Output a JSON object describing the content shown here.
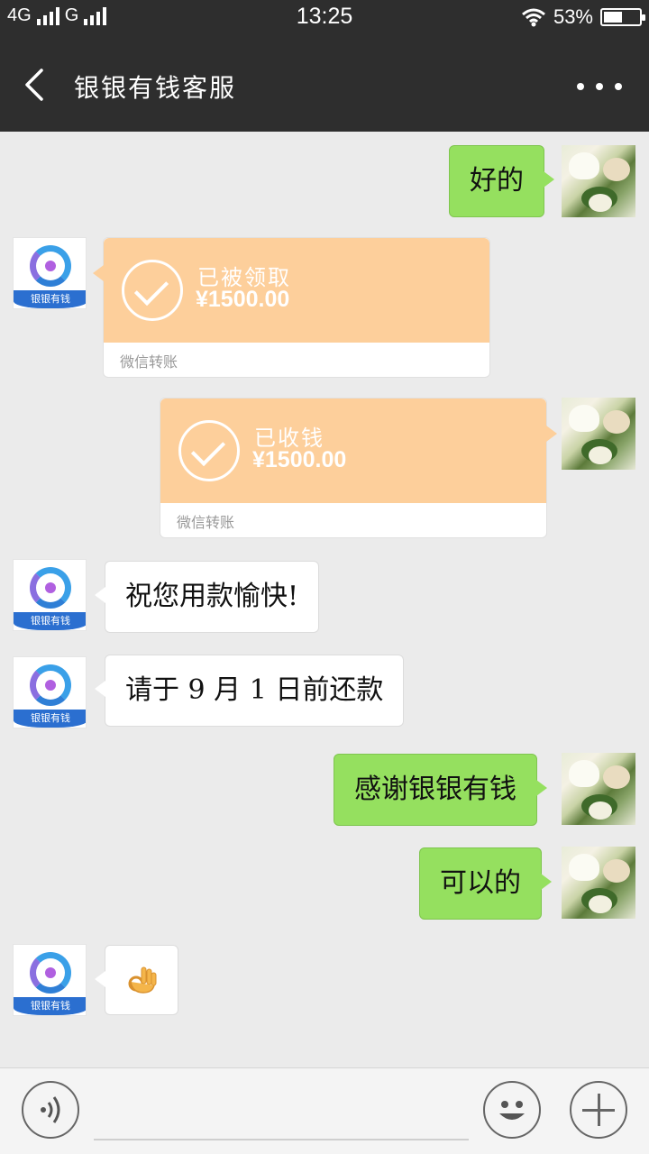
{
  "status_bar": {
    "network_left": "4G",
    "network_right": "G",
    "time": "13:25",
    "battery_percent": "53%",
    "battery_level": 0.53
  },
  "header": {
    "title": "银银有钱客服",
    "back_icon": "back-arrow-icon",
    "more_icon": "more-dots-icon"
  },
  "contact": {
    "logo_text": "银银有钱"
  },
  "messages": [
    {
      "sender": "me",
      "type": "text",
      "text": "好的"
    },
    {
      "sender": "other",
      "type": "transfer",
      "status": "已被领取",
      "amount": "¥1500.00",
      "source": "微信转账"
    },
    {
      "sender": "me",
      "type": "transfer",
      "status": "已收钱",
      "amount": "¥1500.00",
      "source": "微信转账"
    },
    {
      "sender": "other",
      "type": "text",
      "text": "祝您用款愉快!"
    },
    {
      "sender": "other",
      "type": "text",
      "text": "请于 9 月 1 日前还款"
    },
    {
      "sender": "me",
      "type": "text",
      "text": "感谢银银有钱"
    },
    {
      "sender": "me",
      "type": "text",
      "text": "可以的"
    },
    {
      "sender": "other",
      "type": "emoji",
      "emoji": "ok-hand-emoji"
    }
  ],
  "input_bar": {
    "voice_icon": "voice-icon",
    "input_value": "",
    "emoji_icon": "smiley-icon",
    "plus_icon": "plus-icon"
  },
  "colors": {
    "header_bg": "#2e2e2e",
    "chat_bg": "#ebebeb",
    "my_bubble": "#95e05f",
    "transfer_bg": "#fdcf9b"
  }
}
